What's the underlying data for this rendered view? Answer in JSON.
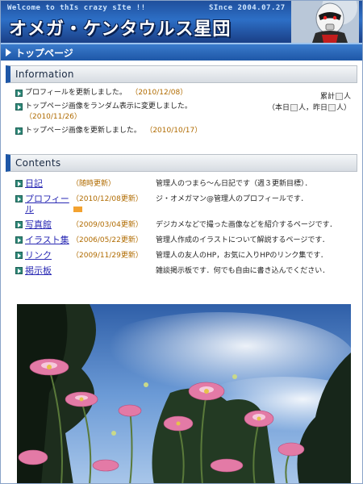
{
  "banner": {
    "welcome": "Welcome to thIs crazy sIte !!",
    "since": "SInce 2004.07.27",
    "title": "オメガ・ケンタウルス星団",
    "mascot": "robot-mascot-icon"
  },
  "page_bar": {
    "label": "トップページ"
  },
  "information": {
    "heading": "Information",
    "items": [
      {
        "text": "プロフィールを更新しました。",
        "date": "（2010/12/08）"
      },
      {
        "text": "トップページ画像をランダム表示に変更しました。",
        "date": "（2010/11/26）"
      },
      {
        "text": "トップページ画像を更新しました。",
        "date": "（2010/10/17）"
      }
    ],
    "counter_total_label": "累計",
    "counter_total_suffix": "人",
    "counter_today_label": "（本日",
    "counter_today_suffix": "人，昨日",
    "counter_yesterday_suffix": "人）"
  },
  "contents": {
    "heading": "Contents",
    "rows": [
      {
        "link": "日記",
        "update": "（随時更新）",
        "desc": "管理人のつまら～ん日記です（週３更新目標）．",
        "new": false
      },
      {
        "link": "プロフィール",
        "update": "（2010/12/08更新）",
        "desc": "ジ・オメガマン@管理人のプロフィールです．",
        "new": true
      },
      {
        "link": "写真館",
        "update": "（2009/03/04更新）",
        "desc": "デジカメなどで撮った画像などを紹介するページです．",
        "new": false
      },
      {
        "link": "イラスト集",
        "update": "（2006/05/22更新）",
        "desc": "管理人作成のイラストについて解説するページです．",
        "new": false
      },
      {
        "link": "リンク",
        "update": "（2009/11/29更新）",
        "desc": "管理人の友人のHP，お気に入りHPのリンク集です．",
        "new": false
      },
      {
        "link": "掲示板",
        "update": "",
        "desc": "雑談掲示板です．何でも自由に書き込んでください．",
        "new": false
      }
    ]
  },
  "photo": {
    "subject": "pink-flowers-against-sky"
  },
  "colors": {
    "banner_blue": "#1f4f9c",
    "accent_blue": "#1e57a7",
    "date_orange": "#b06b00",
    "link_blue": "#2a2ab4"
  }
}
